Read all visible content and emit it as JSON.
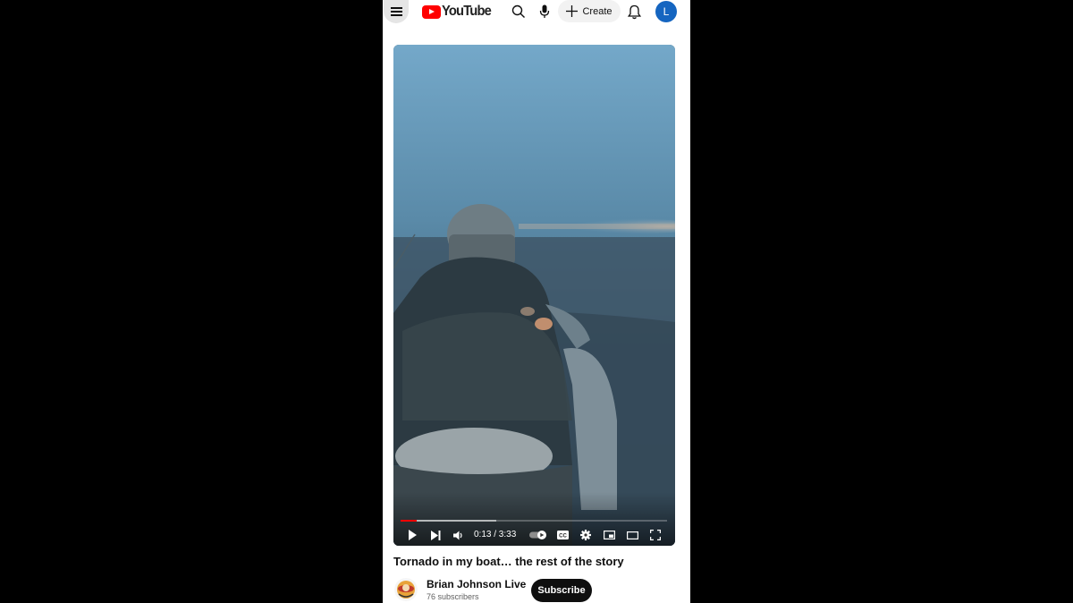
{
  "header": {
    "logo_text": "YouTube",
    "create_label": "Create",
    "avatar_letter": "L",
    "icons": [
      "menu-icon",
      "youtube-logo",
      "search-icon",
      "microphone-icon",
      "plus-icon",
      "bell-icon"
    ]
  },
  "player": {
    "time_current": "0:13",
    "time_total": "3:33",
    "time_display": "0:13 / 3:33",
    "progress_played_fraction": 0.061,
    "progress_buffered_fraction": 0.36,
    "icons": [
      "play-icon",
      "next-icon",
      "volume-icon",
      "autoplay-toggle-icon",
      "captions-icon",
      "settings-icon",
      "miniplayer-icon",
      "theater-icon",
      "fullscreen-icon"
    ]
  },
  "video": {
    "title": "Tornado in my boat… the rest of the story"
  },
  "channel": {
    "name": "Brian Johnson Live",
    "subscribers": "76 subscribers",
    "subscribe_label": "Subscribe"
  },
  "colors": {
    "brand_red": "#ff0000",
    "avatar_blue": "#1565c0",
    "text_primary": "#0f0f0f",
    "text_secondary": "#606060"
  }
}
